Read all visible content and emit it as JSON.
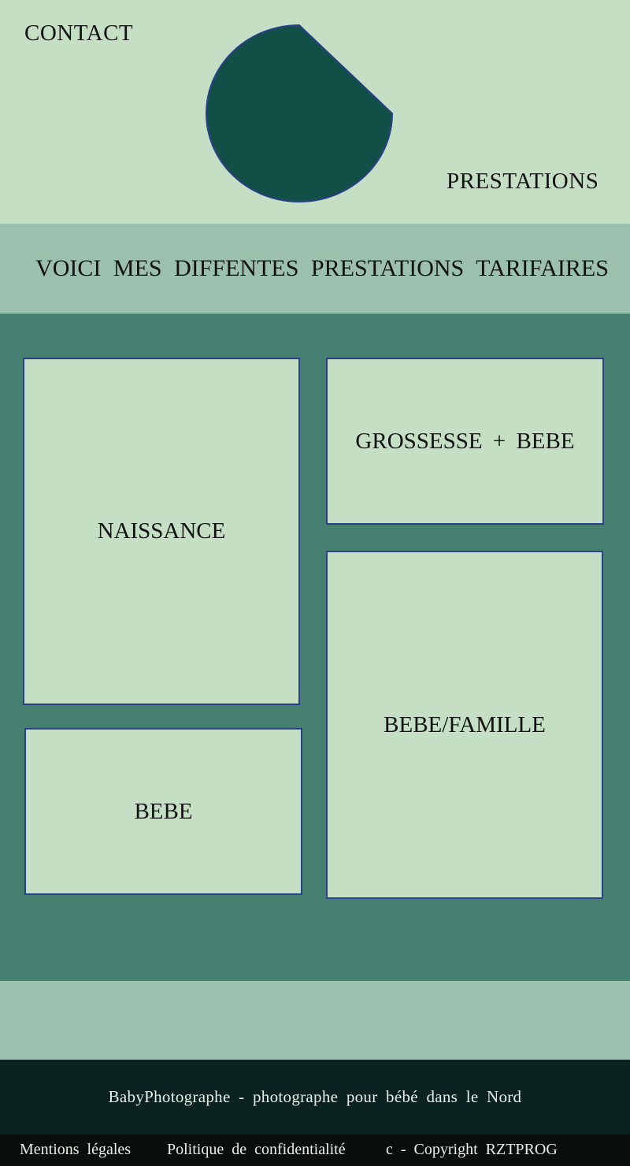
{
  "header": {
    "nav_contact": "CONTACT",
    "nav_prestations": "PRESTATIONS",
    "logo_color": "#114f47",
    "logo_border_color": "#2b3f8a"
  },
  "banner": {
    "title": "VOICI MES DIFFENTES PRESTATIONS TARIFAIRES"
  },
  "services": {
    "cards": [
      {
        "label": "NAISSANCE"
      },
      {
        "label": "GROSSESSE + BEBE"
      },
      {
        "label": "BEBE/FAMILLE"
      },
      {
        "label": "BEBE"
      }
    ]
  },
  "footer": {
    "tagline": "BabyPhotographe - photographe pour bébé dans le Nord",
    "links": [
      {
        "label": "Mentions légales"
      },
      {
        "label": "Politique de confidentialité"
      }
    ],
    "copyright": "c - Copyright RZTPROG"
  },
  "colors": {
    "light_green": "#c5dfc5",
    "mid_green": "#9bc1ae",
    "teal": "#457f70",
    "dark_footer": "#0a2320",
    "black_footer": "#0a0f0e",
    "card_border": "#2b3f8a"
  }
}
